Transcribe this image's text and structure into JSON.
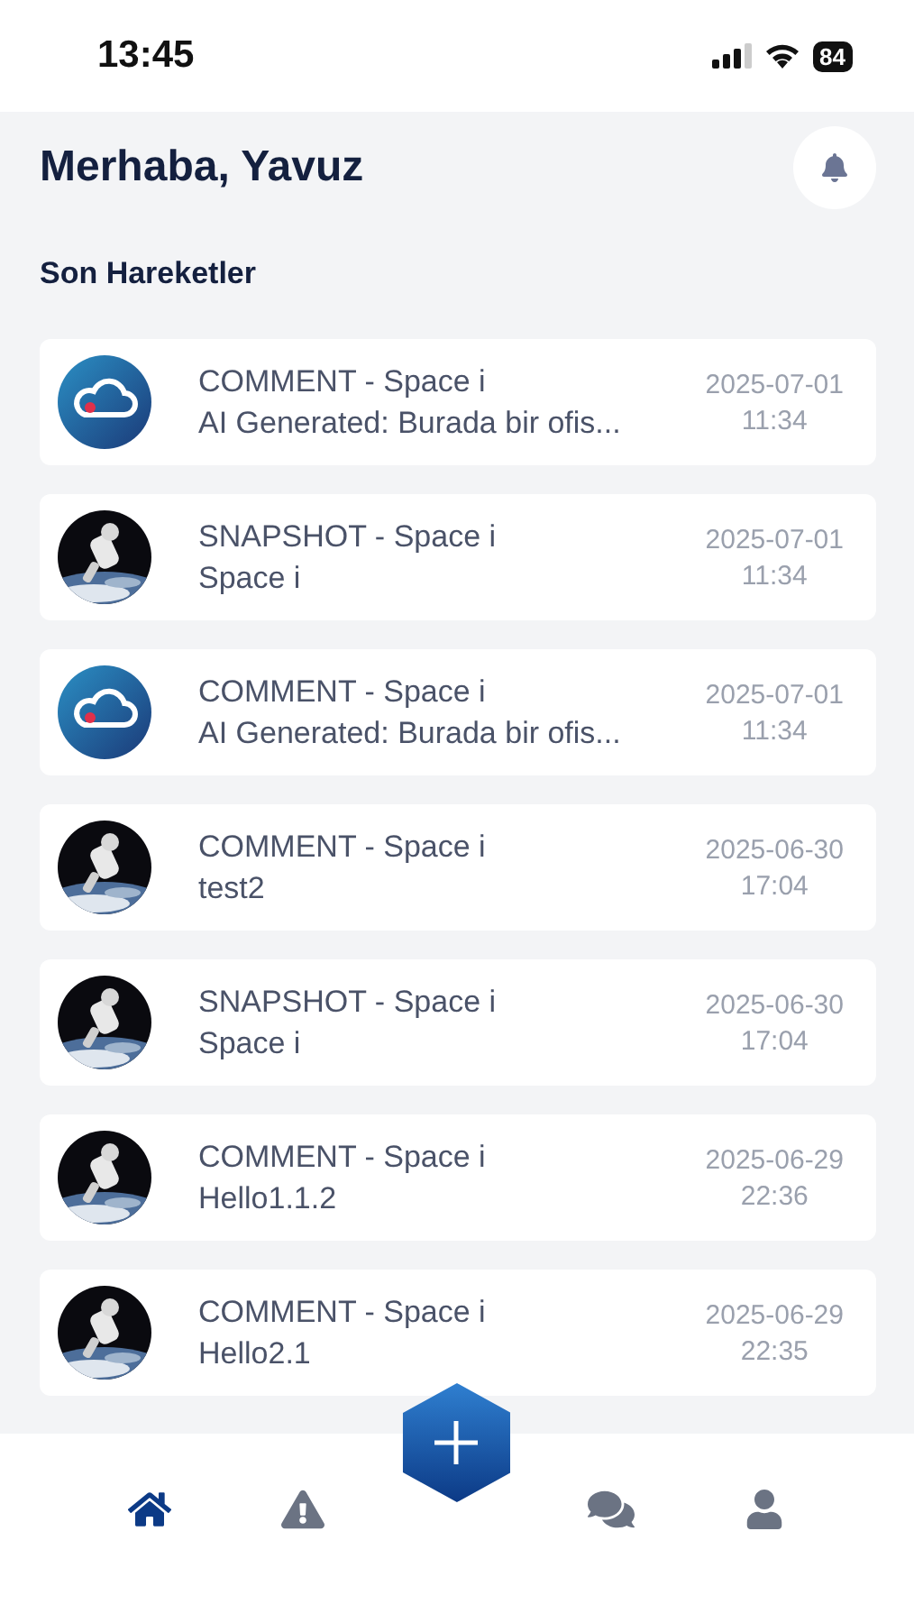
{
  "status_bar": {
    "time": "13:45",
    "battery": "84"
  },
  "header": {
    "greeting": "Merhaba, Yavuz"
  },
  "section_title": "Son Hareketler",
  "activities": [
    {
      "kind": "cloud",
      "title": "COMMENT - Space i",
      "subtitle": "AI Generated: Burada bir ofis...",
      "date": "2025-07-01",
      "time": "11:34"
    },
    {
      "kind": "picture",
      "title": "SNAPSHOT - Space i",
      "subtitle": "Space i",
      "date": "2025-07-01",
      "time": "11:34"
    },
    {
      "kind": "cloud",
      "title": "COMMENT - Space i",
      "subtitle": "AI Generated: Burada bir ofis...",
      "date": "2025-07-01",
      "time": "11:34"
    },
    {
      "kind": "picture",
      "title": "COMMENT - Space i",
      "subtitle": "test2",
      "date": "2025-06-30",
      "time": "17:04"
    },
    {
      "kind": "picture",
      "title": "SNAPSHOT - Space i",
      "subtitle": "Space i",
      "date": "2025-06-30",
      "time": "17:04"
    },
    {
      "kind": "picture",
      "title": "COMMENT - Space i",
      "subtitle": "Hello1.1.2",
      "date": "2025-06-29",
      "time": "22:36"
    },
    {
      "kind": "picture",
      "title": "COMMENT - Space i",
      "subtitle": "Hello2.1",
      "date": "2025-06-29",
      "time": "22:35"
    }
  ],
  "tab_bar": [
    {
      "kind": "home",
      "selected": true
    },
    {
      "kind": "alert",
      "selected": false
    },
    {
      "kind": "add",
      "selected": false
    },
    {
      "kind": "chat",
      "selected": false
    },
    {
      "kind": "user",
      "selected": false
    }
  ]
}
